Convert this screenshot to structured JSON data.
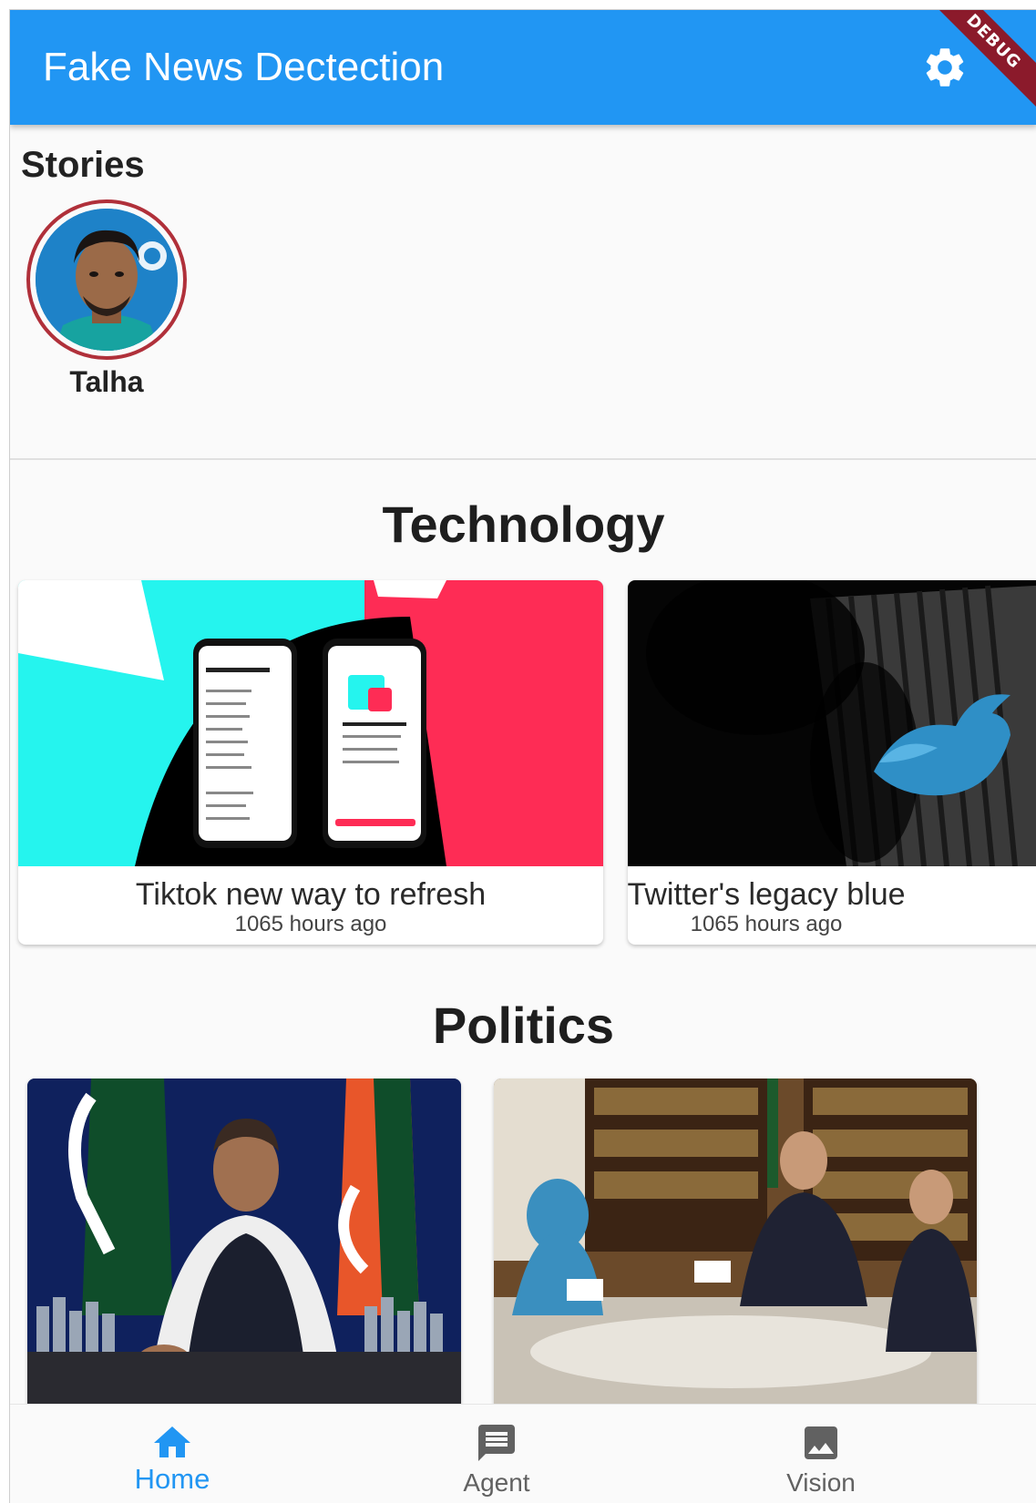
{
  "app": {
    "title": "Fake News Dectection",
    "debug_label": "DEBUG",
    "settings_icon": "gear-icon",
    "accent": "#2196f3"
  },
  "stories": {
    "heading": "Stories",
    "items": [
      {
        "name": "Talha",
        "ring_color": "#b0303a"
      }
    ]
  },
  "sections": [
    {
      "heading": "Technology",
      "cards": [
        {
          "title": "Tiktok new way to refresh",
          "time": "1065 hours ago"
        },
        {
          "title": "Twitter's legacy blue",
          "time": "1065 hours ago"
        }
      ]
    },
    {
      "heading": "Politics",
      "cards": [
        {
          "title": "",
          "time": ""
        },
        {
          "title": "",
          "time": ""
        }
      ]
    }
  ],
  "bottom_nav": {
    "items": [
      {
        "label": "Home",
        "icon": "home-icon",
        "active": true
      },
      {
        "label": "Agent",
        "icon": "message-icon",
        "active": false
      },
      {
        "label": "Vision",
        "icon": "image-icon",
        "active": false
      }
    ],
    "active_color": "#2196f3",
    "inactive_color": "#616161"
  }
}
